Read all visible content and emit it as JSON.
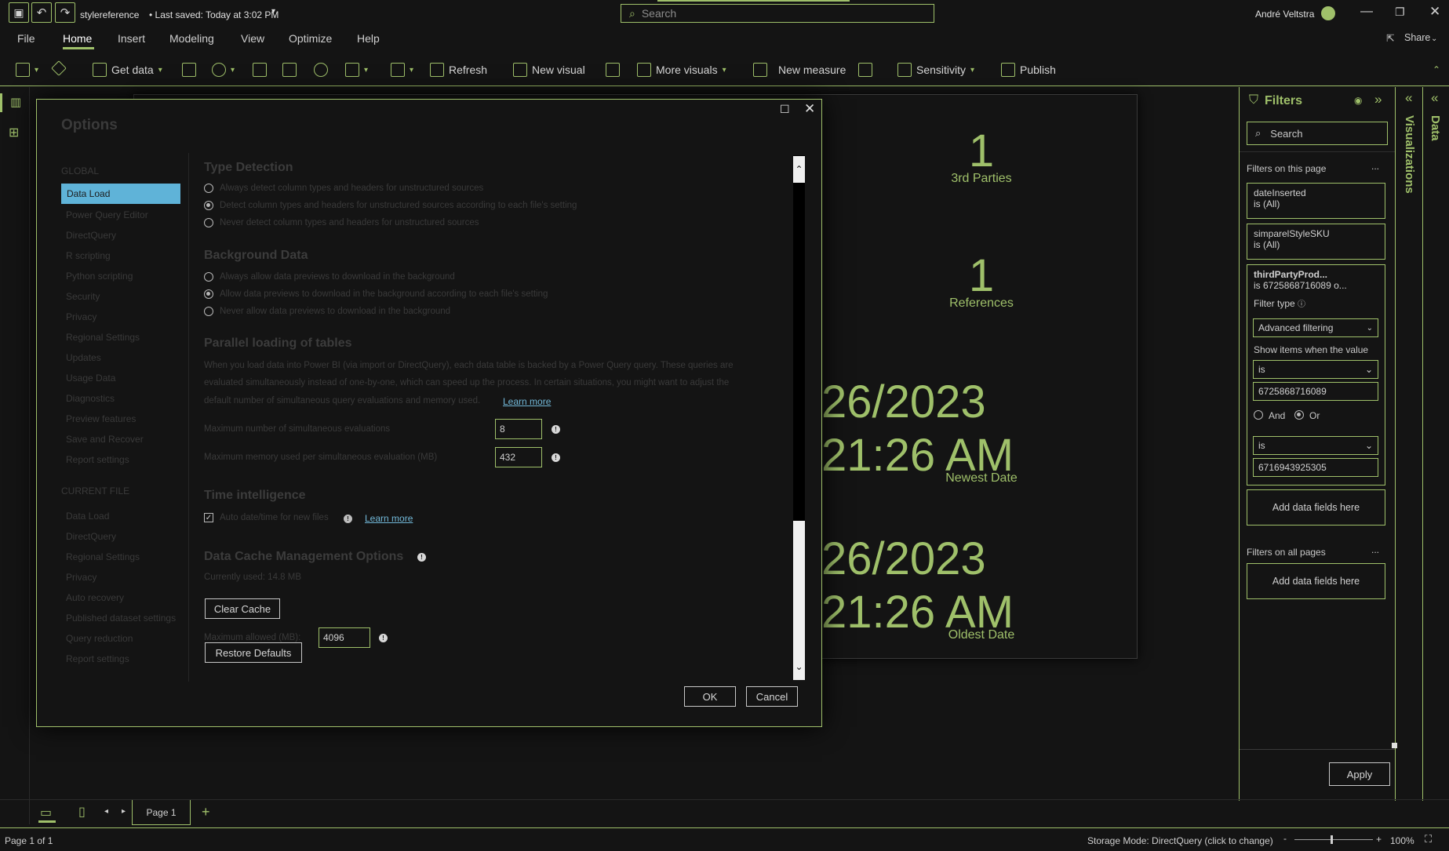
{
  "titlebar": {
    "file_name": "stylereference",
    "saved": "• Last saved: Today at 3:02 PM",
    "search_placeholder": "Search",
    "user": "André Veltstra"
  },
  "menu": [
    "File",
    "Home",
    "Insert",
    "Modeling",
    "View",
    "Optimize",
    "Help"
  ],
  "share": "Share",
  "ribbon": {
    "get_data": "Get data",
    "refresh": "Refresh",
    "new_visual": "New visual",
    "more_visuals": "More visuals",
    "new_measure": "New measure",
    "sensitivity": "Sensitivity",
    "publish": "Publish"
  },
  "canvas": {
    "kpi1": {
      "value": "1",
      "label": "3rd Parties"
    },
    "kpi2": {
      "value": "1",
      "label": "References"
    },
    "kpi3": {
      "date": "26/2023",
      "time": "21:26 AM",
      "label": "Newest Date"
    },
    "kpi4": {
      "date": "26/2023",
      "time": "21:26 AM",
      "label": "Oldest Date"
    }
  },
  "filters": {
    "title": "Filters",
    "search": "Search",
    "on_page": "Filters on this page",
    "cards": [
      {
        "field": "dateInserted",
        "cond": "is (All)"
      },
      {
        "field": "simparelStyleSKU",
        "cond": "is (All)"
      }
    ],
    "active": {
      "field": "thirdPartyProd...",
      "cond": "is 6725868716089 o...",
      "filter_type_label": "Filter type",
      "filter_type": "Advanced filtering",
      "show_items": "Show items when the value",
      "op1": "is",
      "val1": "6725868716089",
      "and": "And",
      "or": "Or",
      "op2": "is",
      "val2": "6716943925305"
    },
    "add_fields": "Add data fields here",
    "on_all_pages": "Filters on all pages",
    "add_fields_all": "Add data fields here",
    "apply": "Apply",
    "more": "..."
  },
  "rails": {
    "visualizations": "Visualizations",
    "data": "Data"
  },
  "pagebar": {
    "page": "Page 1"
  },
  "status": {
    "page_of": "Page 1 of 1",
    "storage": "Storage Mode: DirectQuery (click to change)",
    "zoom": "100%"
  },
  "dialog": {
    "title": "Options",
    "global_header": "GLOBAL",
    "global_items": [
      "Data Load",
      "Power Query Editor",
      "DirectQuery",
      "R scripting",
      "Python scripting",
      "Security",
      "Privacy",
      "Regional Settings",
      "Updates",
      "Usage Data",
      "Diagnostics",
      "Preview features",
      "Save and Recover",
      "Report settings"
    ],
    "current_header": "CURRENT FILE",
    "current_items": [
      "Data Load",
      "DirectQuery",
      "Regional Settings",
      "Privacy",
      "Auto recovery",
      "Published dataset settings",
      "Query reduction",
      "Report settings"
    ],
    "type_detection": {
      "title": "Type Detection",
      "opts": [
        "Always detect column types and headers for unstructured sources",
        "Detect column types and headers for unstructured sources according to each file's setting",
        "Never detect column types and headers for unstructured sources"
      ]
    },
    "background": {
      "title": "Background Data",
      "opts": [
        "Always allow data previews to download in the background",
        "Allow data previews to download in the background according to each file's setting",
        "Never allow data previews to download in the background"
      ]
    },
    "parallel": {
      "title": "Parallel loading of tables",
      "desc1": "When you load data into Power BI (via import or DirectQuery), each data table is backed by a Power Query query. These queries are",
      "desc2": "evaluated simultaneously instead of one-by-one, which can speed up the process. In certain situations, you might want to adjust the",
      "desc3": "default number of simultaneous query evaluations and memory used.",
      "learn": "Learn more",
      "max_eval_label": "Maximum number of simultaneous evaluations",
      "max_eval": "8",
      "max_mem_label": "Maximum memory used per simultaneous evaluation (MB)",
      "max_mem": "432"
    },
    "time": {
      "title": "Time intelligence",
      "auto": "Auto date/time for new files",
      "learn": "Learn more"
    },
    "cache": {
      "title": "Data Cache Management Options",
      "used": "Currently used: 14.8 MB",
      "clear": "Clear Cache",
      "max_label": "Maximum allowed (MB):",
      "max_val": "4096",
      "restore": "Restore Defaults"
    },
    "ok": "OK",
    "cancel": "Cancel"
  }
}
